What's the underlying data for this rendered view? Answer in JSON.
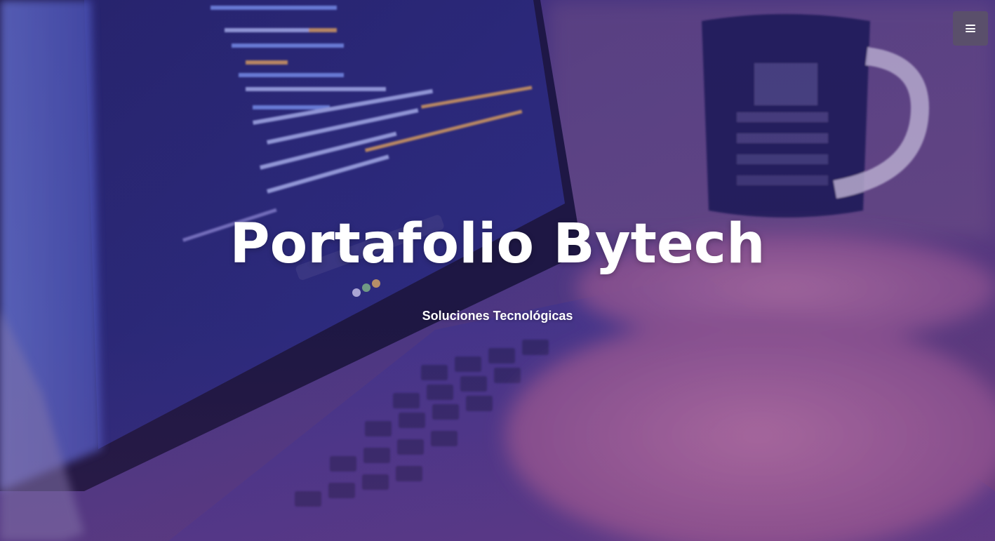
{
  "hero": {
    "title": "Portafolio Bytech",
    "subtitle": "Soluciones Tecnológicas"
  },
  "nav": {
    "menu_icon": "hamburger-menu-icon"
  },
  "background": {
    "description_icon": "laptop-code-photo",
    "tint_color": "#3c2378"
  }
}
